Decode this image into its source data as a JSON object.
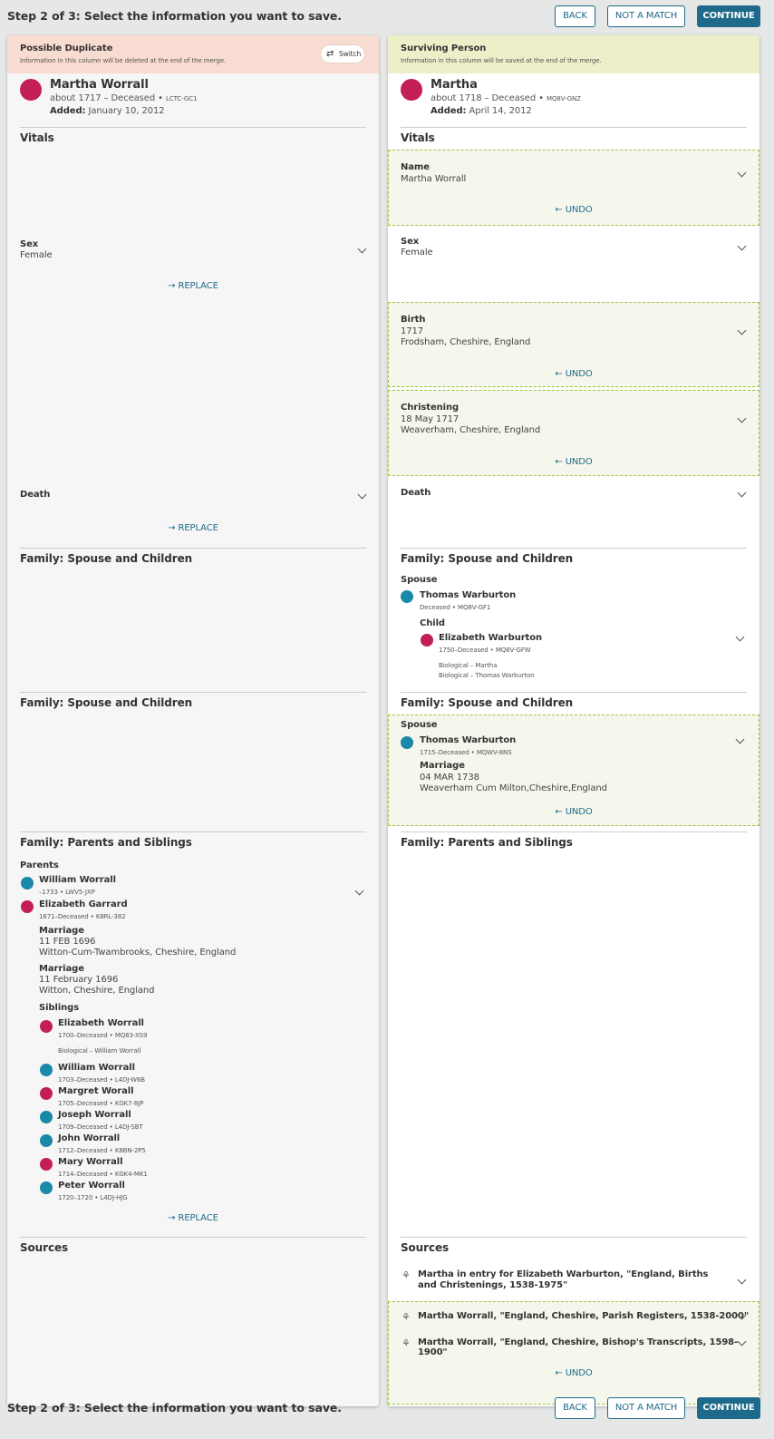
{
  "step_title": "Step 2 of 3: Select the information you want to save.",
  "buttons": {
    "back": "BACK",
    "not_match": "NOT A MATCH",
    "continue": "CONTINUE"
  },
  "colors": {
    "accent": "#1d6a8a",
    "dup_header": "#f8dbd1",
    "surv_header": "#ecefc8",
    "highlight": "#f6f7ec",
    "female": "#c41e56",
    "male": "#1a88a8"
  },
  "left": {
    "header_title": "Possible Duplicate",
    "header_sub": "Information in this column will be deleted at the end of the merge.",
    "switch_label": "Switch",
    "person": {
      "name": "Martha Worrall",
      "life": "about 1717 – Deceased • ",
      "pid": "LCTC-GC1",
      "added_label": "Added:",
      "added": "January 10, 2012"
    },
    "vitals": "Vitals",
    "sex_label": "Sex",
    "sex_val": "Female",
    "replace": "REPLACE",
    "death_label": "Death",
    "fam1": "Family: Spouse and Children",
    "fam2": "Family: Spouse and Children",
    "fam3": "Family: Parents and Siblings",
    "parents_label": "Parents",
    "parents": [
      {
        "name": "William Worrall",
        "meta": "–1733 • LWV5-JXP"
      },
      {
        "name": "Elizabeth Garrard",
        "meta": "1671–Deceased • K8RL-382"
      }
    ],
    "marriages": [
      {
        "label": "Marriage",
        "date": "11 FEB 1696",
        "place": "Witton-Cum-Twambrooks, Cheshire, England"
      },
      {
        "label": "Marriage",
        "date": "11 February 1696",
        "place": "Witton, Cheshire, England"
      }
    ],
    "siblings_label": "Siblings",
    "siblings": [
      {
        "name": "Elizabeth Worrall",
        "meta": "1700–Deceased • MQ83-XS9",
        "rel": "Biological – William Worrall"
      },
      {
        "name": "William Worrall",
        "meta": "1703–Deceased • L4DJ-W6B"
      },
      {
        "name": "Margret Worall",
        "meta": "1705–Deceased • KGK7-8JP"
      },
      {
        "name": "Joseph Worrall",
        "meta": "1709–Deceased • L4DJ-SBT"
      },
      {
        "name": "John Worrall",
        "meta": "1712–Deceased • K8BN-2P5"
      },
      {
        "name": "Mary Worrall",
        "meta": "1714–Deceased • KGK4-MK1"
      },
      {
        "name": "Peter Worrall",
        "meta": "1720–1720 • L4DJ-HJG"
      }
    ],
    "sources": "Sources"
  },
  "right": {
    "header_title": "Surviving Person",
    "header_sub": "Information in this column will be saved at the end of the merge.",
    "person": {
      "name": "Martha",
      "life": "about 1718 – Deceased • ",
      "pid": "MQ8V-GNZ",
      "added_label": "Added:",
      "added": "April 14, 2012"
    },
    "vitals": "Vitals",
    "name_label": "Name",
    "name_val": "Martha Worrall",
    "undo": "UNDO",
    "sex_label": "Sex",
    "sex_val": "Female",
    "birth_label": "Birth",
    "birth_date": "1717",
    "birth_place": "Frodsham, Cheshire, England",
    "chr_label": "Christening",
    "chr_date": "18 May 1717",
    "chr_place": "Weaverham, Cheshire, England",
    "death_label": "Death",
    "fam1": "Family: Spouse and Children",
    "spouse_label": "Spouse",
    "spouse1": {
      "name": "Thomas Warburton",
      "meta": "Deceased • MQ8V-GF1"
    },
    "child_label": "Child",
    "child": {
      "name": "Elizabeth Warburton",
      "meta": "1750–Deceased • MQ8V-GFW",
      "rel1": "Biological – Martha",
      "rel2": "Biological – Thomas Warburton"
    },
    "fam2": "Family: Spouse and Children",
    "spouse2_label": "Spouse",
    "spouse2": {
      "name": "Thomas Warburton",
      "meta": "1715–Deceased • MQWV-8NS"
    },
    "marriage_label": "Marriage",
    "marriage_date": "04 MAR 1738",
    "marriage_place": "Weaverham Cum Milton,Cheshire,England",
    "fam3": "Family: Parents and Siblings",
    "sources": "Sources",
    "source1": "Martha in entry for Elizabeth Warburton, \"England, Births and Christenings, 1538-1975\"",
    "source2": "Martha Worrall, \"England, Cheshire, Parish Registers, 1538-2000\"",
    "source3": "Martha Worrall, \"England, Cheshire, Bishop's Transcripts, 1598-1900\""
  }
}
